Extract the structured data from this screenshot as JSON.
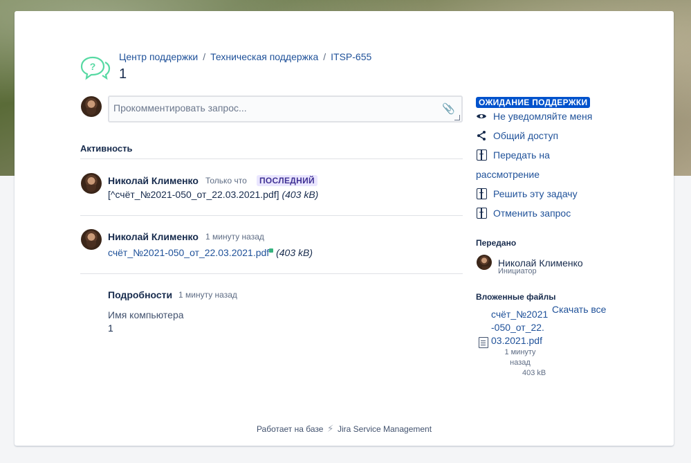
{
  "breadcrumb": {
    "items": [
      "Центр поддержки",
      "Техническая поддержка",
      "ITSP-655"
    ],
    "separator": "/"
  },
  "request": {
    "title": "1"
  },
  "comment": {
    "placeholder": "Прокомментировать запрос..."
  },
  "activity": {
    "heading": "Активность",
    "entries": [
      {
        "author": "Николай Клименко",
        "time": "Только что",
        "badge": "ПОСЛЕДНИЙ",
        "file_text": "[^счёт_№2021-050_от_22.03.2021.pdf]",
        "size": "(403 kB)"
      },
      {
        "author": "Николай Клименко",
        "time": "1 минуту назад",
        "file_link": "счёт_№2021-050_от_22.03.2021.pdf",
        "size": "(403 kB)"
      }
    ],
    "details": {
      "label": "Подробности",
      "time": "1 минуту назад",
      "field_label": "Имя компьютера",
      "field_value": "1"
    }
  },
  "sidebar": {
    "status": "ОЖИДАНИЕ ПОДДЕРЖКИ",
    "actions": {
      "notify": "Не уведомляйте меня",
      "share": "Общий доступ",
      "transfer_line1": "Передать на",
      "transfer_line2": "рассмотрение",
      "resolve": "Решить эту задачу",
      "cancel": "Отменить запрос"
    },
    "assigned_heading": "Передано",
    "assignee": {
      "name": "Николай Клименко",
      "role": "Инициатор"
    },
    "attachments_heading": "Вложенные файлы",
    "download_all": "Скачать все",
    "attachment": {
      "name_lines": [
        "счёт_№2021",
        "-050_от_22.",
        "03.2021.pdf"
      ],
      "time_line1": "1 минуту",
      "time_line2": "назад",
      "size": "403 kB"
    }
  },
  "footer": {
    "prefix": "Работает на базе",
    "product": "Jira Service Management"
  },
  "colors": {
    "link": "#1f5199",
    "status_bg": "#0052cc",
    "badge_bg": "#eae6ff",
    "badge_text": "#403294"
  }
}
